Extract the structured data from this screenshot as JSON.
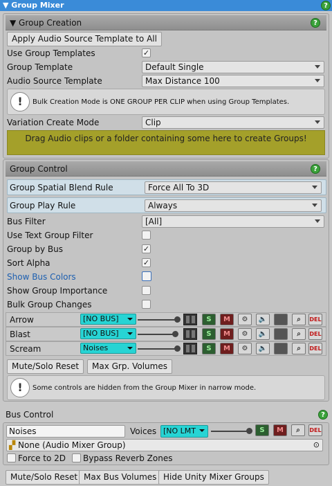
{
  "header": {
    "title": "Group Mixer",
    "help": "?"
  },
  "group_creation": {
    "title": "Group Creation",
    "apply_template_button": "Apply Audio Source Template to All",
    "use_group_templates": {
      "label": "Use Group Templates",
      "checked": true
    },
    "group_template": {
      "label": "Group Template",
      "value": "Default Single"
    },
    "audio_source_template": {
      "label": "Audio Source Template",
      "value": "Max Distance 100"
    },
    "info": "Bulk Creation Mode is ONE GROUP PER CLIP when using Group Templates.",
    "variation_create_mode": {
      "label": "Variation Create Mode",
      "value": "Clip"
    },
    "dropzone": "Drag Audio clips or a folder containing some here to create Groups!"
  },
  "group_control": {
    "title": "Group Control",
    "spatial_blend": {
      "label": "Group Spatial Blend Rule",
      "value": "Force All To 3D"
    },
    "play_rule": {
      "label": "Group Play Rule",
      "value": "Always"
    },
    "bus_filter": {
      "label": "Bus Filter",
      "value": "[All]"
    },
    "options": [
      {
        "label": "Use Text Group Filter",
        "checked": false
      },
      {
        "label": "Group by Bus",
        "checked": true
      },
      {
        "label": "Sort Alpha",
        "checked": true
      },
      {
        "label": "Show Bus Colors",
        "checked": false
      },
      {
        "label": "Show Group Importance",
        "checked": false
      },
      {
        "label": "Bulk Group Changes",
        "checked": false
      }
    ],
    "groups": [
      {
        "name": "Arrow",
        "bus": "[NO BUS]",
        "level": 1.0
      },
      {
        "name": "Blast",
        "bus": "[NO BUS]",
        "level": 0.95
      },
      {
        "name": "Scream",
        "bus": "Noises",
        "level": 1.0
      }
    ],
    "tool_labels": {
      "solo": "S",
      "mute": "M",
      "delete": "DEL"
    },
    "mute_solo_reset": "Mute/Solo Reset",
    "max_group_volumes": "Max Grp. Volumes",
    "info": "Some controls are hidden from the Group Mixer in narrow mode."
  },
  "bus_control": {
    "title": "Bus Control",
    "bus_name": "Noises",
    "voices_label": "Voices",
    "voices_value": "[NO LMT",
    "bus_level": 1.0,
    "mixer_group": "None (Audio Mixer Group)",
    "force_2d": {
      "label": "Force to 2D",
      "checked": false
    },
    "bypass_reverb": {
      "label": "Bypass Reverb Zones",
      "checked": false
    },
    "mute_solo_reset": "Mute/Solo Reset",
    "max_bus_volumes": "Max Bus Volumes",
    "hide_mixer_groups": "Hide Unity Mixer Groups"
  },
  "colors": {
    "header_blue": "#3a8bd8",
    "dropzone_olive": "#a4a02a",
    "bus_cyan": "#27d4d4",
    "solo_green": "#2c5e30",
    "mute_red": "#6e1e1e",
    "help_green": "#3aa23a",
    "link_blue": "#1d5fb0"
  },
  "icons": [
    "triangle-down-icon",
    "help-icon",
    "checkmark-icon",
    "info-icon",
    "meter-bars-icon",
    "gear-icon",
    "speaker-icon",
    "search-icon",
    "object-field-icon"
  ]
}
